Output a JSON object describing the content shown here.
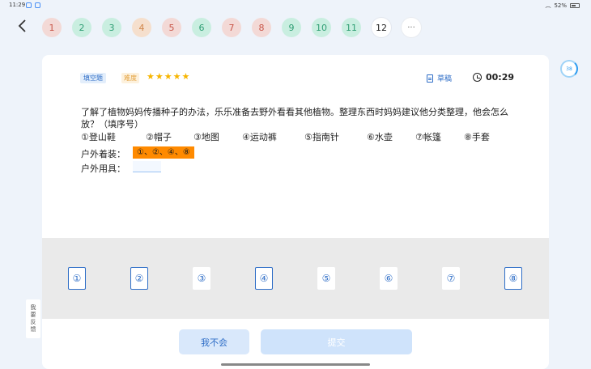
{
  "status": {
    "time": "11:29",
    "battery": "52%"
  },
  "nav": {
    "questions": [
      {
        "label": "1",
        "state": "wrong"
      },
      {
        "label": "2",
        "state": "correct"
      },
      {
        "label": "3",
        "state": "correct"
      },
      {
        "label": "4",
        "state": "partial"
      },
      {
        "label": "5",
        "state": "wrong"
      },
      {
        "label": "6",
        "state": "correct"
      },
      {
        "label": "7",
        "state": "wrong"
      },
      {
        "label": "8",
        "state": "wrong"
      },
      {
        "label": "9",
        "state": "correct"
      },
      {
        "label": "10",
        "state": "correct"
      },
      {
        "label": "11",
        "state": "correct"
      },
      {
        "label": "12",
        "state": "current"
      }
    ],
    "more": "···"
  },
  "timer_badge": "38",
  "feedback": [
    "我",
    "要",
    "反",
    "馈"
  ],
  "card": {
    "type_tag": "填空题",
    "difficulty_label": "难度",
    "stars": [
      "★",
      "★",
      "★",
      "★",
      "★"
    ],
    "draft_label": "草稿",
    "time": "00:29",
    "question": "了解了植物妈妈传播种子的办法，乐乐准备去野外看看其他植物。整理东西时妈妈建议他分类整理，他会怎么放？（填序号）",
    "options": [
      "①登山鞋",
      "②帽子",
      "③地图",
      "④运动裤",
      "⑤指南针",
      "⑥水壶",
      "⑦帐篷",
      "⑧手套"
    ],
    "rows": [
      {
        "label": "户外着装：",
        "answer": "①、②、④、⑧"
      },
      {
        "label": "户外用具：",
        "answer": ""
      }
    ],
    "choices": [
      "①",
      "②",
      "③",
      "④",
      "⑤",
      "⑥",
      "⑦",
      "⑧"
    ],
    "skip_label": "我不会",
    "submit_label": "提交"
  },
  "colors": {
    "accent": "#2f6ec7",
    "filled_answer": "#ff8a00",
    "star": "#f7b500"
  }
}
